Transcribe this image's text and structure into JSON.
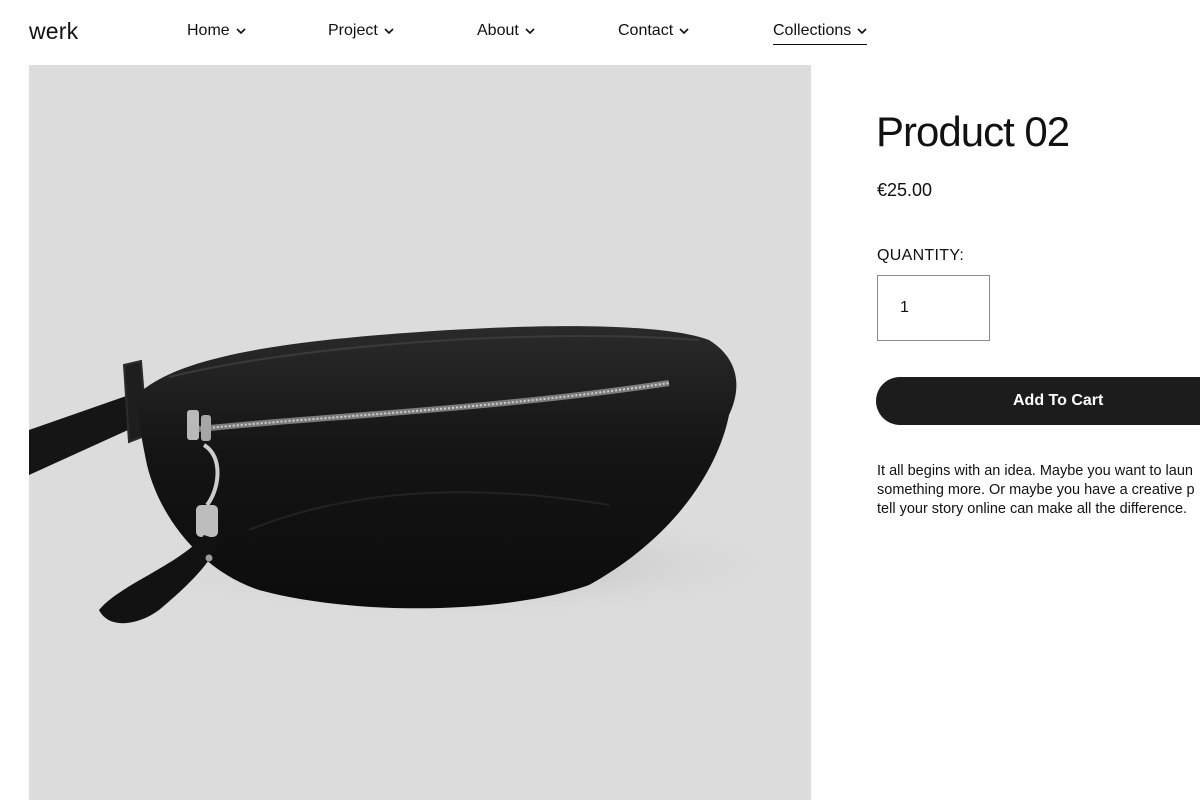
{
  "site": {
    "logo": "werk"
  },
  "nav": {
    "items": [
      {
        "label": "Home"
      },
      {
        "label": "Project"
      },
      {
        "label": "About"
      },
      {
        "label": "Contact"
      },
      {
        "label": "Collections"
      }
    ],
    "active_item": "Collections"
  },
  "product": {
    "title": "Product 02",
    "price": "€25.00",
    "quantity_label": "QUANTITY:",
    "quantity_value": "1",
    "add_to_cart_label": "Add To Cart",
    "description_lines": [
      "It all begins with an idea. Maybe you want to laun",
      "something more. Or maybe you have a creative p",
      "tell your story online can make all the difference."
    ]
  },
  "image": {
    "subject": "black fanny pack with silver zipper",
    "background_color": "#dcdcdc"
  },
  "colors": {
    "button": "#1c1c1c",
    "text": "#111111"
  }
}
